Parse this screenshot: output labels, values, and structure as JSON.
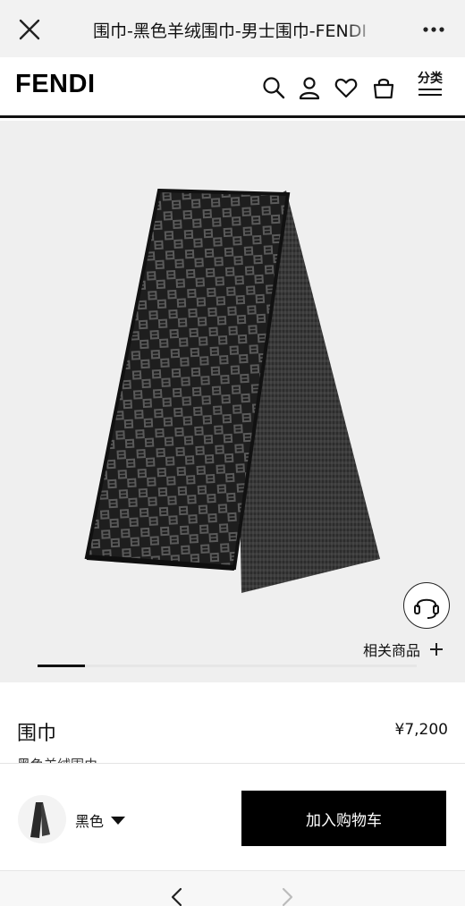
{
  "browser": {
    "title": "围巾-黑色羊绒围巾-男士围巾-FENDI"
  },
  "header": {
    "logo": "FENDI",
    "category_label": "分类"
  },
  "gallery": {
    "related_label": "相关商品",
    "slide_count": 8,
    "active_slide": 1
  },
  "product": {
    "name": "围巾",
    "price": "¥7,200",
    "subtitle": "黑色羊绒围巾"
  },
  "actions": {
    "color_label": "黑色",
    "add_to_cart_label": "加入购物车"
  },
  "colors": {
    "scarf_dark": "#1c1c1c",
    "scarf_pattern": "#4a4a4a",
    "button_bg": "#000000"
  }
}
